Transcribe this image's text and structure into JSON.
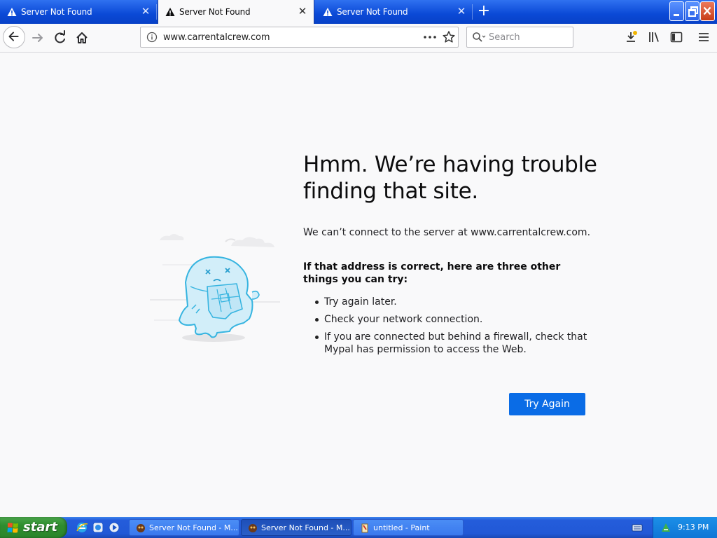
{
  "browser": {
    "tabs": [
      {
        "label": "Server Not Found",
        "selected": false
      },
      {
        "label": "Server Not Found",
        "selected": true
      },
      {
        "label": "Server Not Found",
        "selected": false
      }
    ],
    "url": "www.carrentalcrew.com",
    "search_placeholder": "Search"
  },
  "error": {
    "title": "Hmm. We’re having trouble finding that site.",
    "description": "We can’t connect to the server at www.carrentalcrew.com.",
    "suggest_heading": "If that address is correct, here are three other things you can try:",
    "suggestions": [
      "Try again later.",
      "Check your network connection.",
      "If you are connected but behind a firewall, check that Mypal has permission to access the Web."
    ],
    "button_label": "Try Again"
  },
  "taskbar": {
    "start_label": "start",
    "items": [
      {
        "label": "Server Not Found - M...",
        "active": false
      },
      {
        "label": "Server Not Found - M...",
        "active": true
      },
      {
        "label": "untitled - Paint",
        "active": false
      }
    ],
    "clock": "9:13 PM"
  },
  "colors": {
    "accent_button": "#0a6ce6",
    "tabstrip": "#0a49d6",
    "page_bg": "#f9f9fa"
  }
}
